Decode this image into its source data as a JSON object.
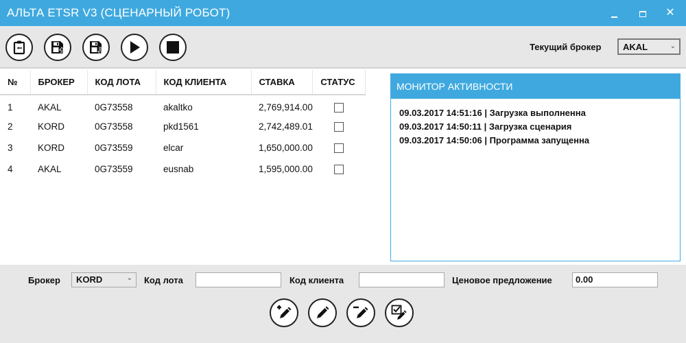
{
  "window": {
    "title": "АЛЬТА ETSR V3 (СЦЕНАРНЫЙ РОБОТ)",
    "minimize_icon": "minimize-icon",
    "maximize_icon": "maximize-icon",
    "close_glyph": "✕"
  },
  "toolbar": {
    "buttons": [
      {
        "name": "clipboard-button",
        "icon": "clipboard-icon"
      },
      {
        "name": "save-upload-button",
        "icon": "save-upload-icon"
      },
      {
        "name": "save-download-button",
        "icon": "save-download-icon"
      },
      {
        "name": "run-button",
        "icon": "play-icon"
      },
      {
        "name": "stop-button",
        "icon": "stop-icon"
      }
    ],
    "broker_label": "Текущий брокер",
    "broker_value": "AKAL"
  },
  "grid": {
    "columns": [
      "№",
      "БРОКЕР",
      "КОД ЛОТА",
      "КОД КЛИЕНТА",
      "СТАВКА",
      "СТАТУС"
    ],
    "rows": [
      {
        "num": "1",
        "broker": "AKAL",
        "lot": "0G73558",
        "client": "akaltko",
        "bid": "2,769,914.00",
        "status": false
      },
      {
        "num": "2",
        "broker": "KORD",
        "lot": "0G73558",
        "client": "pkd1561",
        "bid": "2,742,489.01",
        "status": false
      },
      {
        "num": "3",
        "broker": "KORD",
        "lot": "0G73559",
        "client": "elcar",
        "bid": "1,650,000.00",
        "status": false
      },
      {
        "num": "4",
        "broker": "AKAL",
        "lot": "0G73559",
        "client": "eusnab",
        "bid": "1,595,000.00",
        "status": false
      }
    ]
  },
  "monitor": {
    "title": "МОНИТОР АКТИВНОСТИ",
    "entries": [
      "09.03.2017 14:51:16 | Загрузка выполненна",
      "09.03.2017 14:50:11 | Загрузка сценария",
      "09.03.2017 14:50:06 | Программа запущенна"
    ]
  },
  "editor": {
    "broker_label": "Брокер",
    "broker_value": "KORD",
    "lot_label": "Код лота",
    "lot_value": "",
    "client_label": "Код клиента",
    "client_value": "",
    "price_label": "Ценовое предложение",
    "price_value": "0.00",
    "buttons": [
      {
        "name": "add-row-button",
        "icon": "add-pencil-icon"
      },
      {
        "name": "edit-row-button",
        "icon": "pencil-icon"
      },
      {
        "name": "remove-row-button",
        "icon": "remove-pencil-icon"
      },
      {
        "name": "check-edit-button",
        "icon": "check-pencil-icon"
      }
    ]
  },
  "colors": {
    "accent": "#3fa9df",
    "toolbar_bg": "#e7e7e7"
  }
}
